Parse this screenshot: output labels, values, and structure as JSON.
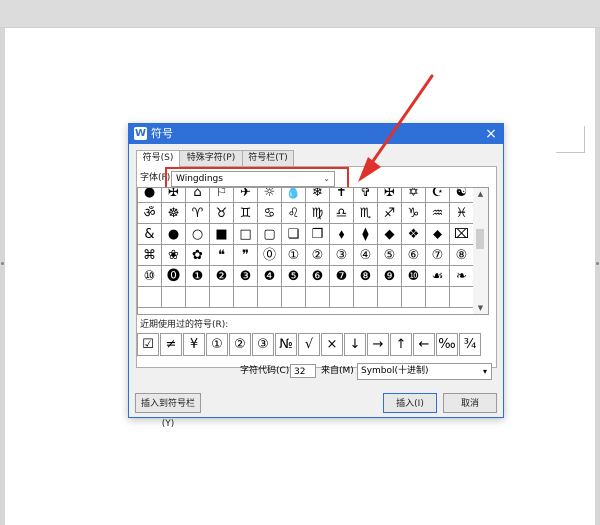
{
  "dialog": {
    "title": "符号",
    "app_icon": "W",
    "close_glyph": "×"
  },
  "tabs": [
    {
      "label": "符号(S)",
      "active": true
    },
    {
      "label": "特殊字符(P)",
      "active": false
    },
    {
      "label": "符号栏(T)",
      "active": false
    }
  ],
  "font": {
    "label": "字体(F):",
    "value": "Wingdings",
    "arrow": "⌄"
  },
  "symbol_grid": [
    [
      "●",
      "✠",
      "⌂",
      "⚐",
      "✈",
      "☼",
      "💧",
      "❄",
      "✝",
      "✞",
      "✠",
      "✡",
      "☪",
      "☯"
    ],
    [
      "ॐ",
      "☸",
      "♈",
      "♉",
      "♊",
      "♋",
      "♌",
      "♍",
      "♎",
      "♏",
      "♐",
      "♑",
      "♒",
      "♓"
    ],
    [
      "&",
      "●",
      "○",
      "■",
      "□",
      "▢",
      "❑",
      "❒",
      "⬧",
      "⧫",
      "◆",
      "❖",
      "⬥",
      "⌧"
    ],
    [
      "⌘",
      "❀",
      "✿",
      "❝",
      "❞",
      "⓪",
      "①",
      "②",
      "③",
      "④",
      "⑤",
      "⑥",
      "⑦",
      "⑧"
    ],
    [
      "⑩",
      "⓿",
      "❶",
      "❷",
      "❸",
      "❹",
      "❺",
      "❻",
      "❼",
      "❽",
      "❾",
      "❿",
      "☙",
      "❧"
    ],
    [
      "",
      "",
      "",
      "",
      "",
      "",
      "",
      "",
      "",
      "",
      "",
      "",
      "",
      ""
    ]
  ],
  "recent": {
    "label": "近期使用过的符号(R):",
    "symbols": [
      "☑",
      "≠",
      "¥",
      "①",
      "②",
      "③",
      "№",
      "√",
      "×",
      "↓",
      "→",
      "↑",
      "←",
      "‰",
      "¾"
    ]
  },
  "code": {
    "label": "字符代码(C):",
    "value": "32",
    "from_label": "来自(M)",
    "from_value": "Symbol(十进制)",
    "from_arrow": "▾"
  },
  "buttons": {
    "insert_to_bar": "插入到符号栏(Y)",
    "insert": "插入(I)",
    "cancel": "取消"
  },
  "scroll": {
    "up": "▲",
    "down": "▼"
  },
  "colors": {
    "accent": "#2f6fd8",
    "annotation": "#e0322c"
  }
}
